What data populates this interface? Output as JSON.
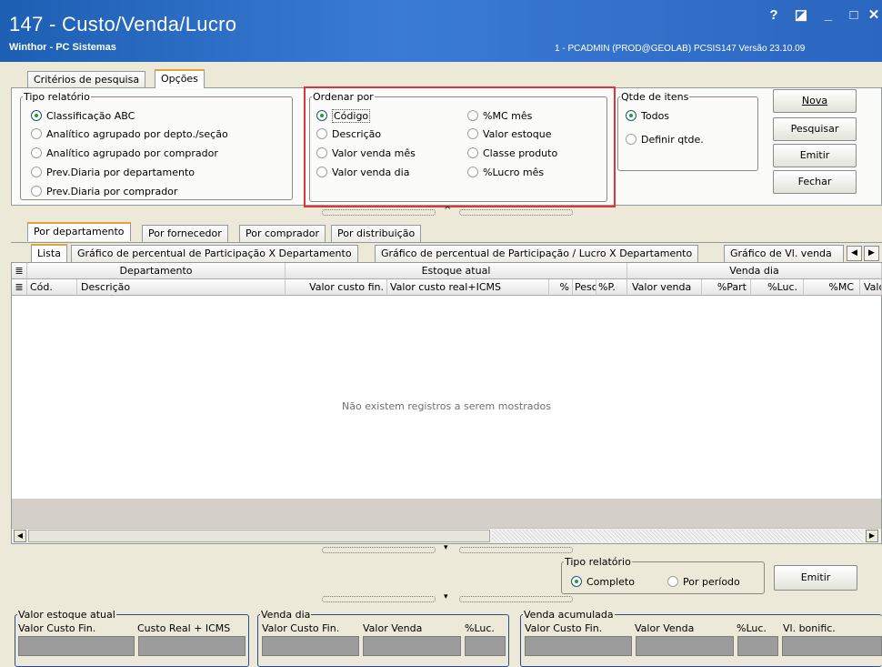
{
  "window": {
    "title": "147 - Custo/Venda/Lucro",
    "subtitle": "Winthor - PC Sistemas",
    "info": "1 - PCADMIN (PROD@GEOLAB)  PCSIS147  Versão 23.10.09",
    "buttons": {
      "help": "?",
      "restore": "◪",
      "minimize": "_",
      "maximize": "□",
      "close": "✕"
    }
  },
  "top_tabs": [
    "Critérios de pesquisa",
    "Opções"
  ],
  "tipo_relatorio": {
    "legend": "Tipo relatório",
    "options": [
      "Classificação ABC",
      "Analítico agrupado por depto./seção",
      "Analítico agrupado por comprador",
      "Prev.Diaria por departamento",
      "Prev.Diaria por comprador"
    ],
    "selected": 0
  },
  "ordenar_por": {
    "legend": "Ordenar por",
    "col1": [
      "Código",
      "Descrição",
      "Valor venda mês",
      "Valor venda dia"
    ],
    "col2": [
      "%MC mês",
      "Valor estoque",
      "Classe produto",
      "%Lucro mês"
    ],
    "selected": "Código"
  },
  "qtde_itens": {
    "legend": "Qtde de itens",
    "options": [
      "Todos",
      "Definir qtde."
    ],
    "selected": 0
  },
  "actions": {
    "nova": "Nova",
    "pesquisar": "Pesquisar",
    "emitir": "Emitir",
    "fechar": "Fechar"
  },
  "group_tabs": [
    "Por departamento",
    "Por fornecedor",
    "Por comprador",
    "Por distribuição"
  ],
  "view_tabs": [
    "Lista",
    "Gráfico de percentual de Participação X Departamento",
    "Gráfico de percentual de Participação / Lucro X Departamento",
    "Gráfico de Vl. venda"
  ],
  "grid": {
    "group_headers": [
      "Departamento",
      "Estoque atual",
      "Venda dia"
    ],
    "columns": [
      "Cód.",
      "Descrição",
      "Valor custo fin.",
      "Valor custo real+ICMS",
      "%",
      "Peso",
      "%P.",
      "Valor venda",
      "%Part",
      "%Luc.",
      "%MC",
      "Valor"
    ],
    "empty_message": "Não existem registros a serem mostrados"
  },
  "tipo_relatorio2": {
    "legend": "Tipo relatório",
    "options": [
      "Completo",
      "Por período"
    ],
    "selected": 0
  },
  "emitir2": "Emitir",
  "summary": {
    "estoque": {
      "legend": "Valor estoque  atual",
      "labels": [
        "Valor Custo Fin.",
        "Custo Real + ICMS"
      ]
    },
    "venda_dia": {
      "legend": "Venda dia",
      "labels": [
        "Valor Custo Fin.",
        "Valor Venda",
        "%Luc."
      ]
    },
    "venda_acum": {
      "legend": "Venda acumulada",
      "labels": [
        "Valor Custo Fin.",
        "Valor Venda",
        "%Luc.",
        "Vl. bonific."
      ]
    }
  },
  "colors": {
    "title_bar": "#2b66c0",
    "highlight_box": "#e0343a",
    "tab_accent": "#e8a23a"
  }
}
